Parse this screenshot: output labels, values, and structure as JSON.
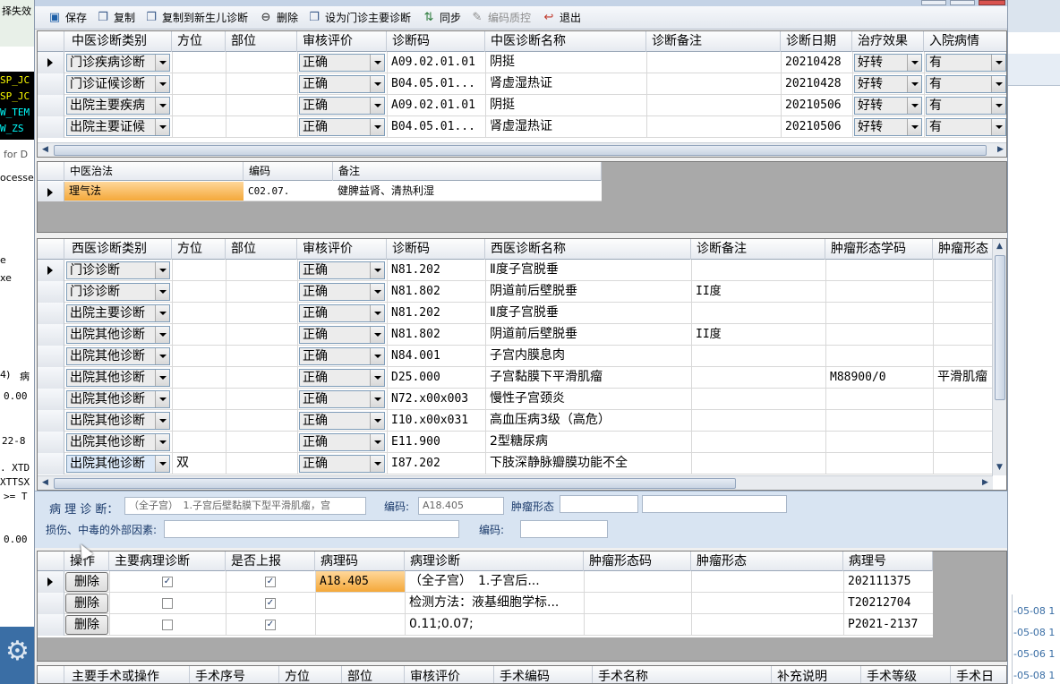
{
  "background_left": {
    "lines": [
      "择失效",
      "SP_JC",
      "SP_JC",
      "W_TEM",
      "W_ZS",
      "for D",
      "ocesse",
      "e",
      "xe",
      "4)",
      "病",
      "0.00",
      "22-8",
      ". XTD",
      "XTTSX",
      ">= T",
      "0.00"
    ]
  },
  "background_right": {
    "dates": [
      "-05-08 1",
      "-05-08 1",
      "-05-06 1",
      "-05-08 1"
    ]
  },
  "toolbar": {
    "items": [
      {
        "icon": "save-icon",
        "label": "保存"
      },
      {
        "icon": "copy-icon",
        "label": "复制"
      },
      {
        "icon": "copy-newborn-icon",
        "label": "复制到新生儿诊断"
      },
      {
        "icon": "delete-icon",
        "label": "删除"
      },
      {
        "icon": "set-main-icon",
        "label": "设为门诊主要诊断"
      },
      {
        "icon": "sync-icon",
        "label": "同步"
      },
      {
        "icon": "qc-icon",
        "label": "编码质控"
      },
      {
        "icon": "exit-icon",
        "label": "退出"
      }
    ]
  },
  "tcm_diag": {
    "headers": [
      "中医诊断类别",
      "方位",
      "部位",
      "审核评价",
      "诊断码",
      "中医诊断名称",
      "诊断备注",
      "诊断日期",
      "治疗效果",
      "入院病情"
    ],
    "rows": [
      {
        "type": "门诊疾病诊断",
        "pos": "",
        "part": "",
        "audit": "正确",
        "code": "A09.02.01.01",
        "name": "阴挺",
        "note": "",
        "date": "20210428",
        "effect": "好转",
        "admit": "有"
      },
      {
        "type": "门诊证候诊断",
        "pos": "",
        "part": "",
        "audit": "正确",
        "code": "B04.05.01...",
        "name": "肾虚湿热证",
        "note": "",
        "date": "20210428",
        "effect": "好转",
        "admit": "有"
      },
      {
        "type": "出院主要疾病",
        "pos": "",
        "part": "",
        "audit": "正确",
        "code": "A09.02.01.01",
        "name": "阴挺",
        "note": "",
        "date": "20210506",
        "effect": "好转",
        "admit": "有"
      },
      {
        "type": "出院主要证候",
        "pos": "",
        "part": "",
        "audit": "正确",
        "code": "B04.05.01...",
        "name": "肾虚湿热证",
        "note": "",
        "date": "20210506",
        "effect": "好转",
        "admit": "有"
      }
    ]
  },
  "tcm_method": {
    "headers": [
      "中医治法",
      "编码",
      "备注"
    ],
    "rows": [
      {
        "method": "理气法",
        "code": "C02.07.",
        "note": "健脾益肾、清热利湿"
      }
    ]
  },
  "wm_diag": {
    "headers": [
      "西医诊断类别",
      "方位",
      "部位",
      "审核评价",
      "诊断码",
      "西医诊断名称",
      "诊断备注",
      "肿瘤形态学码",
      "肿瘤形态"
    ],
    "rows": [
      {
        "type": "门诊诊断",
        "pos": "",
        "audit": "正确",
        "code": "N81.202",
        "name": "Ⅱ度子宫脱垂",
        "note": "",
        "morph_code": "",
        "morph": ""
      },
      {
        "type": "门诊诊断",
        "pos": "",
        "audit": "正确",
        "code": "N81.802",
        "name": "阴道前后壁脱垂",
        "note": "II度",
        "morph_code": "",
        "morph": ""
      },
      {
        "type": "出院主要诊断",
        "pos": "",
        "audit": "正确",
        "code": "N81.202",
        "name": "Ⅱ度子宫脱垂",
        "note": "",
        "morph_code": "",
        "morph": ""
      },
      {
        "type": "出院其他诊断",
        "pos": "",
        "audit": "正确",
        "code": "N81.802",
        "name": "阴道前后壁脱垂",
        "note": "II度",
        "morph_code": "",
        "morph": ""
      },
      {
        "type": "出院其他诊断",
        "pos": "",
        "audit": "正确",
        "code": "N84.001",
        "name": "子宫内膜息肉",
        "note": "",
        "morph_code": "",
        "morph": ""
      },
      {
        "type": "出院其他诊断",
        "pos": "",
        "audit": "正确",
        "code": "D25.000",
        "name": "子宫黏膜下平滑肌瘤",
        "note": "",
        "morph_code": "M88900/0",
        "morph": "平滑肌瘤"
      },
      {
        "type": "出院其他诊断",
        "pos": "",
        "audit": "正确",
        "code": "N72.x00x003",
        "name": "慢性子宫颈炎",
        "note": "",
        "morph_code": "",
        "morph": ""
      },
      {
        "type": "出院其他诊断",
        "pos": "",
        "audit": "正确",
        "code": "I10.x00x031",
        "name": "高血压病3级（高危）",
        "note": "",
        "morph_code": "",
        "morph": ""
      },
      {
        "type": "出院其他诊断",
        "pos": "",
        "audit": "正确",
        "code": "E11.900",
        "name": "2型糖尿病",
        "note": "",
        "morph_code": "",
        "morph": ""
      },
      {
        "type": "出院其他诊断",
        "pos": "双",
        "audit": "正确",
        "code": "I87.202",
        "name": "下肢深静脉瓣膜功能不全",
        "note": "",
        "morph_code": "",
        "morph": ""
      }
    ]
  },
  "pathology": {
    "diag_label": "病 理 诊 断：",
    "diag_value": "（全子宫）　1.子宫后壁黏膜下型平滑肌瘤，宫",
    "code_label": "编码:",
    "code_value": "A18.405",
    "morph_label": "肿瘤形态",
    "morph_value": "",
    "morph_extra": "",
    "injury_label": "损伤、中毒的外部因素:",
    "injury_value": "",
    "injury_code_label": "编码:",
    "injury_code_value": ""
  },
  "patho_grid": {
    "headers": [
      "操作",
      "主要病理诊断",
      "是否上报",
      "病理码",
      "病理诊断",
      "肿瘤形态码",
      "肿瘤形态",
      "病理号"
    ],
    "rows": [
      {
        "action": "删除",
        "main": true,
        "report": true,
        "code": "A18.405",
        "diag": "（全子宫）　1.子宫后...",
        "morph_code": "",
        "morph": "",
        "no": "202111375"
      },
      {
        "action": "删除",
        "main": false,
        "report": true,
        "code": "",
        "diag": "检测方法：液基细胞学标...",
        "morph_code": "",
        "morph": "",
        "no": "T20212704"
      },
      {
        "action": "删除",
        "main": false,
        "report": true,
        "code": "",
        "diag": "0.11;0.07;",
        "morph_code": "",
        "morph": "",
        "no": "P2021-2137"
      }
    ]
  },
  "surgery": {
    "headers": [
      "主要手术或操作",
      "手术序号",
      "方位",
      "部位",
      "审核评价",
      "手术编码",
      "手术名称",
      "补充说明",
      "手术等级",
      "手术日"
    ]
  }
}
